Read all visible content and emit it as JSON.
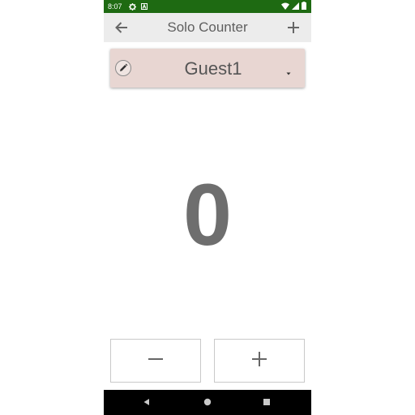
{
  "status_bar": {
    "time": "8:07",
    "left_icons": [
      "settings-icon",
      "a-badge-icon"
    ],
    "right_icons": [
      "wifi-icon",
      "signal-icon",
      "battery-icon"
    ],
    "background": "#1e6a12"
  },
  "app_bar": {
    "title": "Solo Counter",
    "back_icon": "arrow-back-icon",
    "action_icon": "add-icon",
    "background": "#ececec"
  },
  "player_selector": {
    "name": "Guest1",
    "edit_icon": "pencil-icon",
    "dropdown_icon": "caret-down-icon",
    "background": "#e8d6d2"
  },
  "counter": {
    "value": "0"
  },
  "controls": {
    "decrement_icon": "minus-icon",
    "increment_icon": "plus-icon"
  },
  "nav_bar": {
    "buttons": [
      "back-triangle-icon",
      "home-circle-icon",
      "recents-square-icon"
    ]
  }
}
